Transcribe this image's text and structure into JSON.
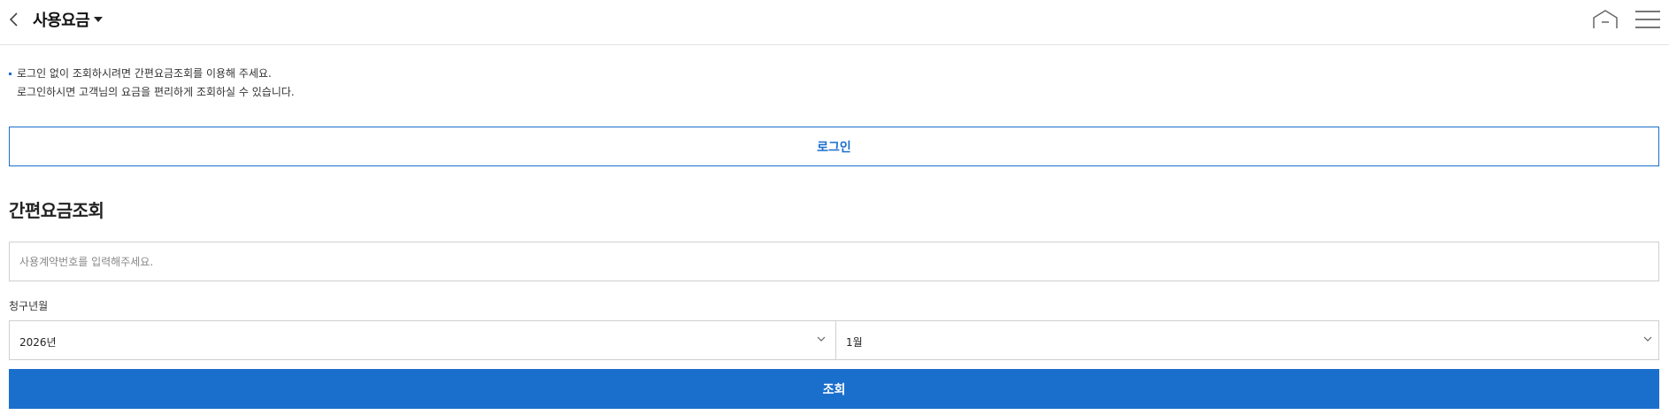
{
  "header": {
    "title": "사용요금",
    "back_icon": "chevron-left-icon",
    "home_icon": "home-icon",
    "menu_icon": "hamburger-menu-icon"
  },
  "notice": {
    "line1": "로그인 없이 조회하시려면 간편요금조회를 이용해 주세요.",
    "line2": "로그인하시면 고객님의 요금을 편리하게 조회하실 수 있습니다."
  },
  "login_button": "로그인",
  "quick_lookup": {
    "title": "간편요금조회",
    "contract_placeholder": "사용계약번호를 입력해주세요.",
    "contract_value": "",
    "billing_label": "청구년월",
    "year_value": "2026년",
    "month_value": "1월",
    "search_button": "조회"
  },
  "colors": {
    "accent": "#1b6fcc",
    "border": "#cfcfcf"
  }
}
